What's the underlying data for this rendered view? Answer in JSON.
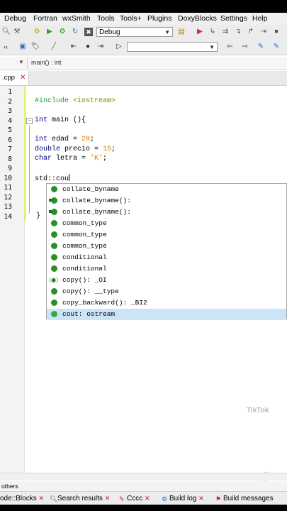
{
  "menubar": {
    "items": [
      "Debug",
      "Fortran",
      "wxSmith",
      "Tools",
      "Tools+",
      "Plugins",
      "DoxyBlocks",
      "Settings",
      "Help"
    ]
  },
  "toolbar": {
    "build_target": "Debug"
  },
  "navigation": {
    "function_scope": "main() : int"
  },
  "editor": {
    "tab_label": ".cpp",
    "line_numbers": [
      "1",
      "2",
      "3",
      "4",
      "5",
      "6",
      "7",
      "8",
      "9",
      "10",
      "11",
      "12",
      "13",
      "14"
    ],
    "code": {
      "include_directive": "#include",
      "include_header": "<iostream>",
      "main_type": "int",
      "main_sig": " main (){",
      "edad_type": "int",
      "edad_rest": " edad = ",
      "edad_value": "28",
      "precio_type": "double",
      "precio_rest": " precio = ",
      "precio_value": "15",
      "letra_type": "char",
      "letra_rest": " letra = ",
      "letra_value": "'K'",
      "semicolon": ";",
      "typed": "std::cou",
      "closing_brace": "}"
    }
  },
  "autocomplete": {
    "items": [
      {
        "label": "collate_byname",
        "icon": "class-icon"
      },
      {
        "label": "collate_byname():",
        "icon": "constructor-icon"
      },
      {
        "label": "collate_byname():",
        "icon": "constructor-icon"
      },
      {
        "label": "common_type",
        "icon": "class-icon"
      },
      {
        "label": "common_type",
        "icon": "class-icon"
      },
      {
        "label": "common_type",
        "icon": "class-icon"
      },
      {
        "label": "conditional",
        "icon": "class-icon"
      },
      {
        "label": "conditional",
        "icon": "class-icon"
      },
      {
        "label": "copy(): _OI",
        "icon": "function-icon"
      },
      {
        "label": "copy(): __type",
        "icon": "class-icon"
      },
      {
        "label": "copy_backward(): _BI2",
        "icon": "class-icon"
      },
      {
        "label": "cout: ostream",
        "icon": "variable-icon",
        "selected": true
      }
    ]
  },
  "bottom_panel": {
    "header": "others",
    "tabs": [
      "ode::Blocks",
      "Search results",
      "Cccc",
      "Build log",
      "Build messages"
    ]
  },
  "watermark": {
    "brand": "TikTok"
  },
  "colors": {
    "selection": "#cce4f8",
    "preprocessor": "#1f9a3a",
    "keyword": "#00008b",
    "number": "#e07a00"
  }
}
